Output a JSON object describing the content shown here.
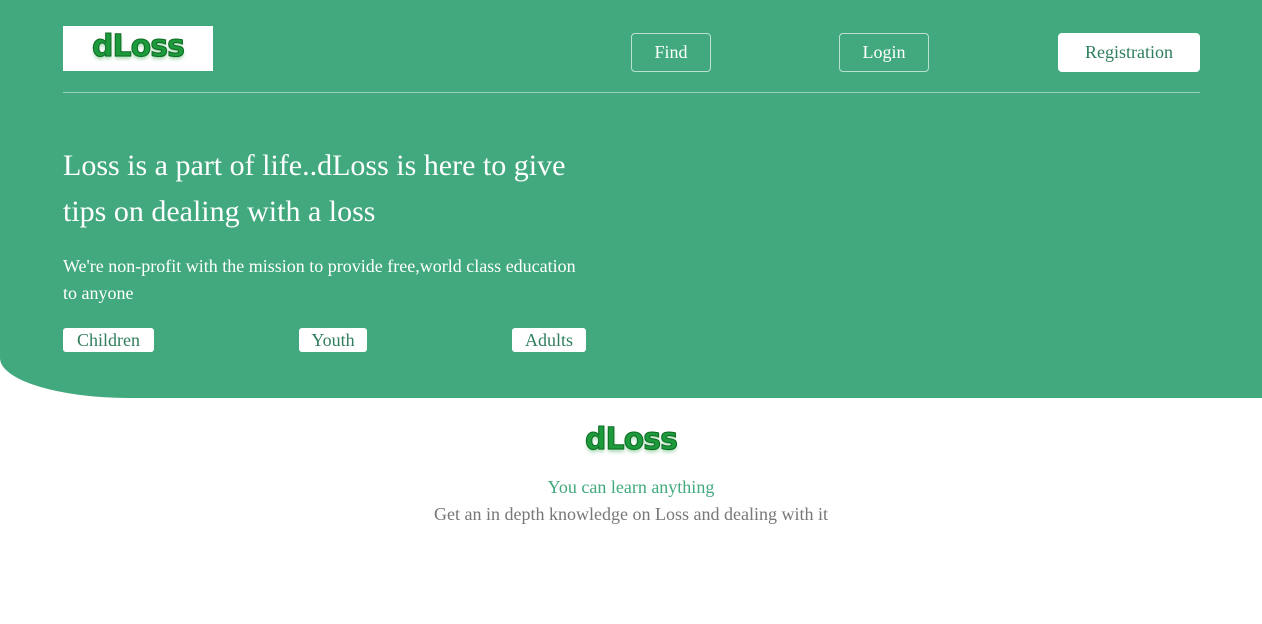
{
  "header": {
    "logo_text": "dLoss",
    "nav": {
      "find_label": "Find",
      "login_label": "Login",
      "registration_label": "Registration"
    }
  },
  "hero": {
    "headline": "Loss is a part of life..dLoss is here to give tips on dealing with a loss",
    "subline": "We're non-profit with the mission to provide free,world class education to anyone",
    "categories": [
      "Children",
      "Youth",
      "Adults"
    ]
  },
  "intro": {
    "logo_text": "dLoss",
    "tagline": "You can learn anything",
    "description": "Get an in depth knowledge on Loss and dealing with it"
  },
  "colors": {
    "brand_green": "#41a97d",
    "logo_green": "#1d9a3c",
    "button_text": "#2f7e5b",
    "muted_text": "#777777"
  }
}
